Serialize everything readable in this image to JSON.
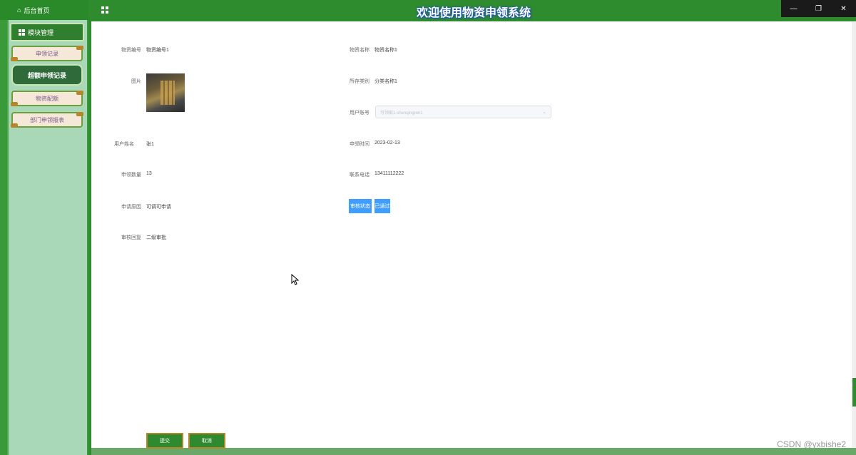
{
  "sidebar": {
    "home_label": "后台首页",
    "menu_header": "模块管理",
    "items": [
      {
        "label": "申领记录"
      },
      {
        "label": "超额申领记录"
      },
      {
        "label": "物资配额"
      },
      {
        "label": "部门申领报表"
      }
    ]
  },
  "header": {
    "title": "欢迎使用物资申领系统"
  },
  "window_controls": {
    "minimize": "—",
    "restore": "❐",
    "close": "✕"
  },
  "form": {
    "material_code": {
      "label": "物资编号",
      "value": "物资编号1"
    },
    "material_name": {
      "label": "物资名称",
      "value": "物资名称1"
    },
    "image": {
      "label": "图片"
    },
    "category": {
      "label": "所存类别",
      "value": "分类名称1"
    },
    "user_id": {
      "label": "用户账号",
      "placeholder": "可领取1-shenqingren1"
    },
    "user_name": {
      "label": "用户姓名",
      "value": "张1"
    },
    "apply_time": {
      "label": "申领时间",
      "value": "2023-02-13"
    },
    "apply_qty": {
      "label": "申领数量",
      "value": "13"
    },
    "phone": {
      "label": "联系电话",
      "value": "13411112222"
    },
    "reason": {
      "label": "申请原因",
      "value": "可调可申请"
    },
    "review_status": {
      "label": "审核状态",
      "value": "已通过"
    },
    "review_reply": {
      "label": "审核回复",
      "value": "二级审批"
    }
  },
  "actions": {
    "submit": "提交",
    "cancel": "取消"
  },
  "watermark": "CSDN @yxbishe2",
  "colors": {
    "primary_green": "#2e8b2e",
    "status_blue": "#409eff",
    "sidebar_bg": "#a8d8b8"
  }
}
